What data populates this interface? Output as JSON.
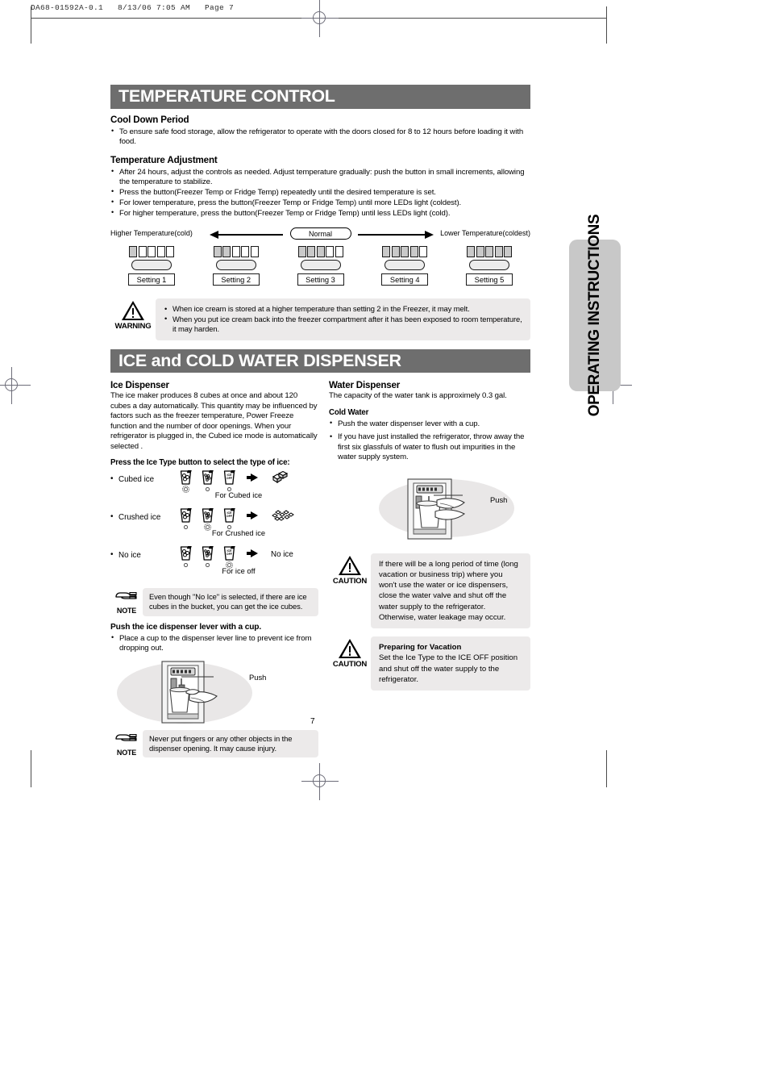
{
  "prepress": {
    "header": "DA68-01592A-0.1   8/13/06 7:05 AM   Page 7"
  },
  "side_tab": {
    "label": "OPERATING INSTRUCTIONS"
  },
  "page_number": "7",
  "sections": [
    {
      "title": "TEMPERATURE CONTROL",
      "cool_down": {
        "heading": "Cool Down Period",
        "bullets": [
          "To ensure safe food storage, allow the refrigerator to operate with the doors closed for 8 to 12 hours before loading it with food."
        ]
      },
      "temp_adjust": {
        "heading": "Temperature Adjustment",
        "bullets": [
          "After 24 hours, adjust the controls as needed. Adjust temperature gradually: push the button in small increments, allowing the temperature to stabilize.",
          "Press the button(Freezer Temp or Fridge Temp) repeatedly until the desired temperature is set.",
          "For lower temperature, press the button(Freezer Temp or Fridge Temp) until more LEDs light (coldest).",
          "For higher temperature, press the button(Freezer Temp or Fridge Temp) until less LEDs light (cold)."
        ]
      }
    }
  ],
  "scale": {
    "left_label": "Higher Temperature(cold)",
    "right_label": "Lower Temperature(coldest)",
    "center_label": "Normal",
    "total_leds": 5,
    "settings": [
      {
        "name": "Setting 1",
        "leds_on": 1
      },
      {
        "name": "Setting 2",
        "leds_on": 2
      },
      {
        "name": "Setting 3",
        "leds_on": 3
      },
      {
        "name": "Setting 4",
        "leds_on": 4
      },
      {
        "name": "Setting 5",
        "leds_on": 5
      }
    ]
  },
  "warning": {
    "label": "WARNING",
    "bullets": [
      "When ice cream is stored at a higher temperature than setting 2 in the Freezer, it may melt.",
      "When you put ice cream back into the freezer compartment after it has been exposed to room temperature, it may harden."
    ]
  },
  "dispenser_section": {
    "title": "ICE and COLD WATER DISPENSER"
  },
  "ice_dispenser": {
    "heading": "Ice Dispenser",
    "paragraph": "The ice maker produces 8 cubes at once and about 120 cubes a day automatically. This quantity may be influenced by factors such as the freezer temperature, Power Freeze function and the number of door openings. When your refrigerator is plugged in, the Cubed ice mode is automatically selected .",
    "select_heading": "Press the Ice Type button to select the type of ice:",
    "types": [
      {
        "label": "Cubed ice",
        "caption": "For Cubed ice",
        "result": "",
        "result_icon": "cubed-ice-icon",
        "active_index": 0
      },
      {
        "label": "Crushed ice",
        "caption": "For Crushed ice",
        "result": "",
        "result_icon": "crushed-ice-icon",
        "active_index": 1
      },
      {
        "label": "No ice",
        "caption": "For ice off",
        "result": "No ice",
        "result_icon": "",
        "active_index": 2
      }
    ],
    "button_glyphs": [
      "cubed-ice-glass",
      "crushed-ice-glass",
      "ice-off-glass"
    ],
    "ice_off_text_line1": "ICE",
    "ice_off_text_line2": "OFF",
    "note1": {
      "label": "NOTE",
      "text": "Even though \"No Ice\" is selected, if there are ice cubes in the bucket, you can get the ice cubes."
    },
    "lever_heading": "Push the ice dispenser lever with a cup.",
    "lever_bullets": [
      "Place a cup to the dispenser lever line to prevent ice from dropping out."
    ],
    "illustration_label": "Push",
    "note2": {
      "label": "NOTE",
      "text": "Never put fingers or any other objects in the dispenser opening. It may cause injury."
    }
  },
  "water_dispenser": {
    "heading": "Water Dispenser",
    "paragraph": "The capacity of the water tank is approximely 0.3 gal.",
    "cold_water_heading": "Cold Water",
    "bullets": [
      "Push the water dispenser lever with a cup.",
      "If you have just installed the refrigerator, throw away the first six glassfuls of water to flush out impurities in the water supply system."
    ],
    "illustration_label": "Push",
    "caution1": {
      "label": "CAUTION",
      "text": "If there will be a long period of time (long vacation or business trip) where you won't use the water or ice dispensers, close the water valve and shut off the water supply to the refrigerator. Otherwise, water leakage may occur."
    },
    "caution2": {
      "label": "CAUTION",
      "title": "Preparing for Vacation",
      "text": "Set the Ice Type to the ICE OFF position and shut off the water supply to the refrigerator."
    }
  },
  "colors": {
    "titlebar_bg": "#6e6e6e",
    "titlebar_text": "#ffffff",
    "alertbox_bg": "#eceaea",
    "tab_bg": "#c8c8c8",
    "led_on": "#c9c9c9"
  }
}
